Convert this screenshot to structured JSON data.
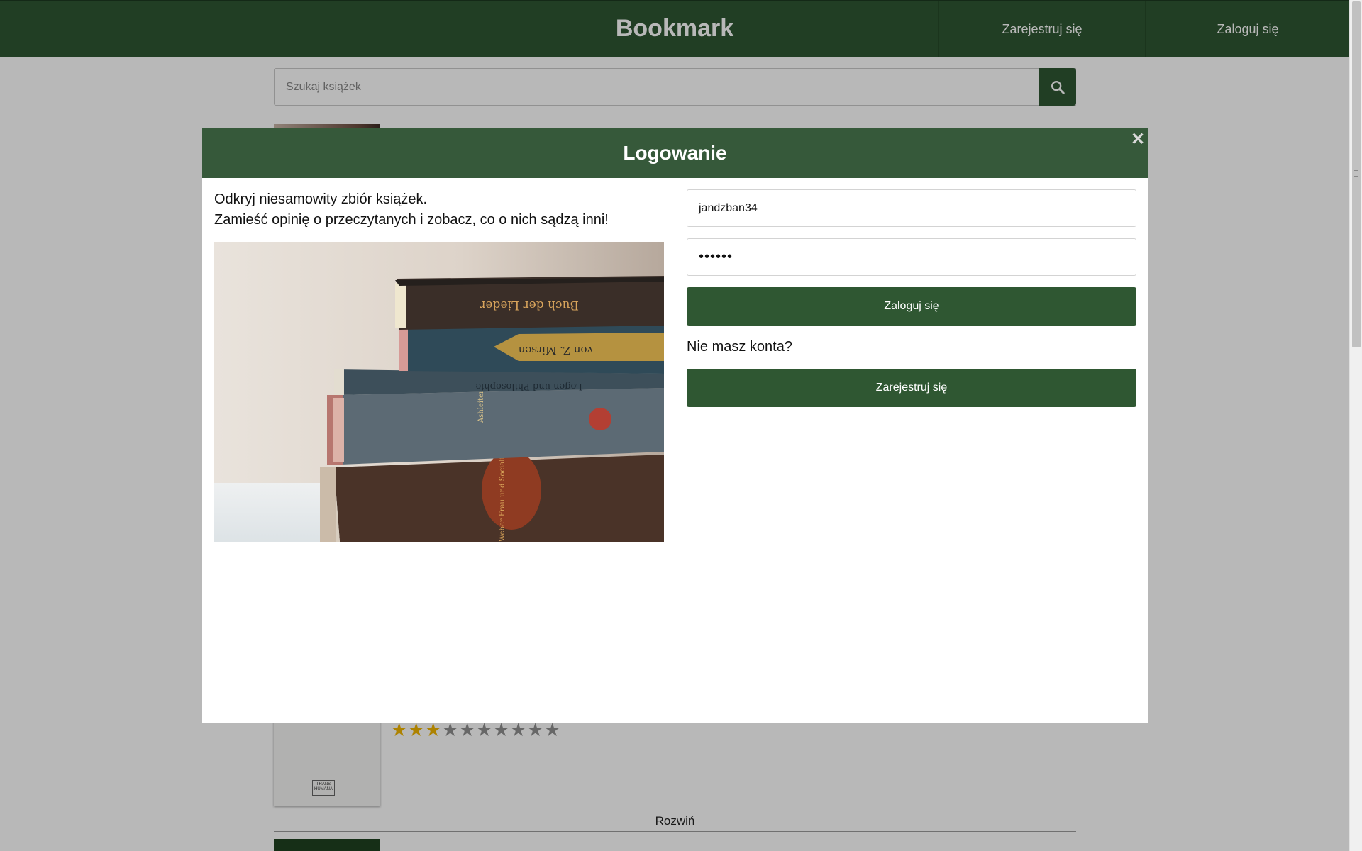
{
  "header": {
    "brand": "Bookmark",
    "register_label": "Zarejestruj się",
    "login_label": "Zaloguj się"
  },
  "search": {
    "placeholder": "Szukaj książek",
    "icon": "search-icon"
  },
  "list": {
    "rating": {
      "filled": 3,
      "total": 10
    },
    "publisher_logo_text": "TRANS HUMANA",
    "expand_label": "Rozwiń"
  },
  "modal": {
    "title": "Logowanie",
    "close_glyph": "✕",
    "intro_line1": "Odkryj niesamowity zbiór książek.",
    "intro_line2": "Zamieść opinię o przeczytanych i zobacz, co o nich sądzą inni!",
    "username_value": "jandzban34",
    "password_value": "••••••",
    "login_button": "Zaloguj się",
    "no_account": "Nie masz konta?",
    "register_button": "Zarejestruj się",
    "photo_spine_titles": [
      "Buch der Lieder",
      "von Z. Mirsen",
      "Logen und Philosophie",
      "Ashleitenb Clatisimus",
      "Weber Frau und Socialismus"
    ]
  },
  "colors": {
    "brand_green": "#2f5732",
    "modal_header_green": "#36593a",
    "star_gold": "#f0b400",
    "star_gray": "#8f8f8f"
  }
}
